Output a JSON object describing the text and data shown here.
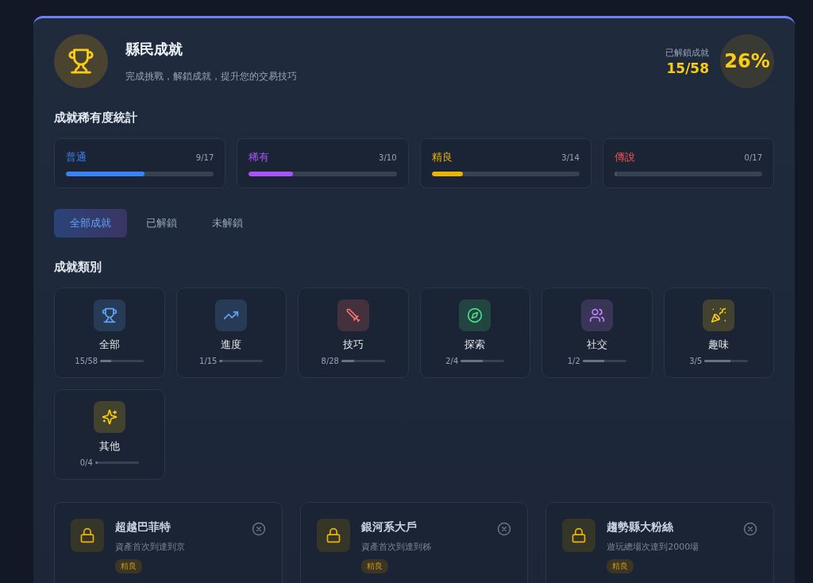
{
  "header": {
    "title": "縣民成就",
    "subtitle": "完成挑戰，解鎖成就，提升您的交易技巧",
    "unlocked_label": "已解鎖成就",
    "unlocked_count": "15/58",
    "percent": "26%"
  },
  "rarity": {
    "title": "成就稀有度統計",
    "items": [
      {
        "label": "普通",
        "count": "9/17",
        "level": 0.53,
        "color": "#3b82f6"
      },
      {
        "label": "稀有",
        "count": "3/10",
        "level": 0.3,
        "color": "#a855f7"
      },
      {
        "label": "精良",
        "count": "3/14",
        "level": 0.21,
        "color": "#eab308"
      },
      {
        "label": "傳說",
        "count": "0/17",
        "level": 0,
        "color": "#f05252"
      }
    ]
  },
  "tabs": [
    {
      "label": "全部成就",
      "selected": true
    },
    {
      "label": "已解鎖",
      "selected": false
    },
    {
      "label": "未解鎖",
      "selected": false
    }
  ],
  "categories": {
    "title": "成就類別",
    "items": [
      {
        "kind": "trophy",
        "label": "全部",
        "count": "15/58",
        "level": 0.26,
        "color": "#60a5fa"
      },
      {
        "kind": "trend",
        "label": "進度",
        "count": "1/15",
        "level": 0.07,
        "color": "#60a5fa"
      },
      {
        "kind": "sword",
        "label": "技巧",
        "count": "8/28",
        "level": 0.29,
        "color": "#f87171"
      },
      {
        "kind": "compass",
        "label": "探索",
        "count": "2/4",
        "level": 0.5,
        "color": "#4ade80"
      },
      {
        "kind": "people",
        "label": "社交",
        "count": "1/2",
        "level": 0.5,
        "color": "#c084fc"
      },
      {
        "kind": "party",
        "label": "趣味",
        "count": "3/5",
        "level": 0.6,
        "color": "#facc15"
      },
      {
        "kind": "sparkle",
        "label": "其他",
        "count": "0/4",
        "level": 0,
        "color": "#facc15"
      }
    ]
  },
  "achievements": [
    {
      "title": "超越巴菲特",
      "description": "資產首次到達到京",
      "tag": "精良"
    },
    {
      "title": "銀河系大戶",
      "description": "資產首次到達到秭",
      "tag": "精良"
    },
    {
      "title": "趨勢縣大粉絲",
      "description": "遊玩總場次達到2000場",
      "tag": "精良"
    }
  ]
}
